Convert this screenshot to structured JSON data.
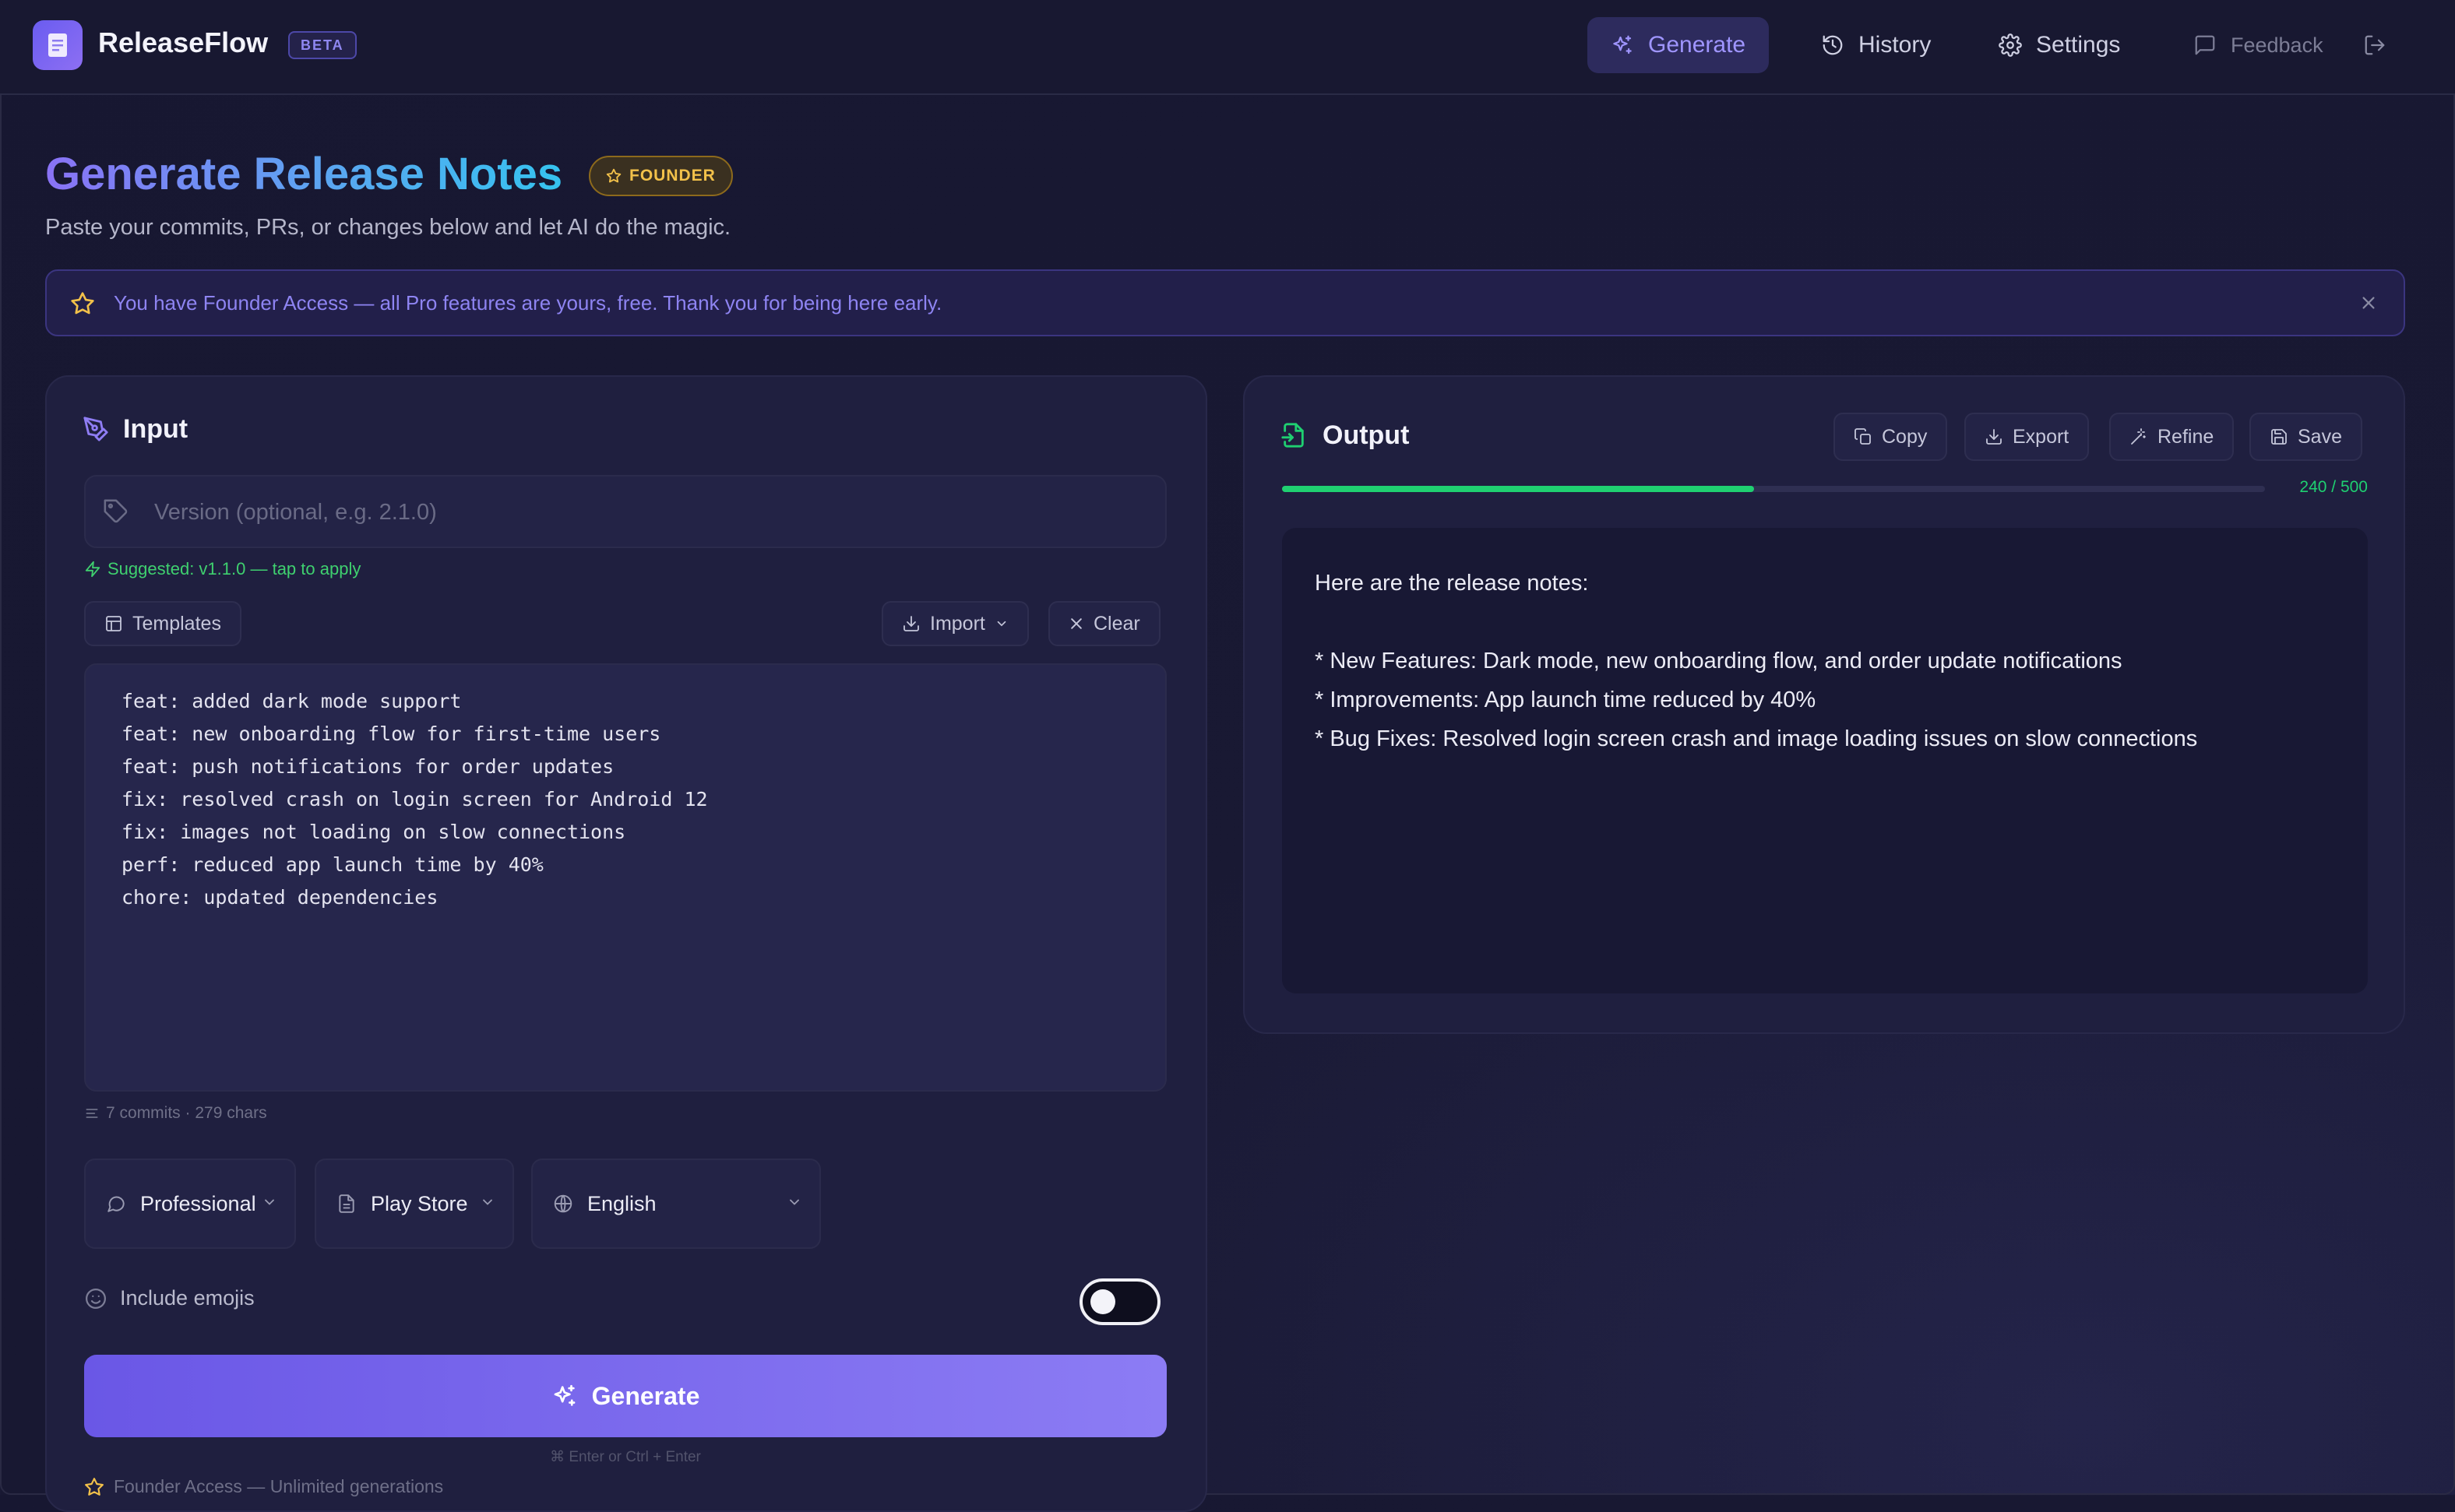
{
  "app": {
    "name": "ReleaseFlow",
    "badge": "BETA"
  },
  "nav": {
    "generate": "Generate",
    "history": "History",
    "settings": "Settings",
    "feedback": "Feedback"
  },
  "header": {
    "title": "Generate Release Notes",
    "founder_badge": "FOUNDER",
    "subtitle": "Paste your commits, PRs, or changes below and let AI do the magic."
  },
  "banner": {
    "text": "You have Founder Access — all Pro features are yours, free. Thank you for being here early."
  },
  "input": {
    "heading": "Input",
    "version_placeholder": "Version (optional, e.g. 2.1.0)",
    "suggestion": "Suggested: v1.1.0 — tap to apply",
    "templates_label": "Templates",
    "import_label": "Import",
    "clear_label": "Clear",
    "commits": "feat: added dark mode support\nfeat: new onboarding flow for first-time users\nfeat: push notifications for order updates\nfix: resolved crash on login screen for Android 12\nfix: images not loading on slow connections\nperf: reduced app launch time by 40%\nchore: updated dependencies",
    "counts": "7 commits · 279 chars",
    "tone": "Professional",
    "platform": "Play Store",
    "language": "English",
    "emoji_label": "Include emojis",
    "emoji_enabled": false,
    "generate_label": "Generate",
    "shortcut": "⌘ Enter  or  Ctrl + Enter",
    "founder_footer": "Founder Access — Unlimited generations"
  },
  "output": {
    "heading": "Output",
    "copy_label": "Copy",
    "export_label": "Export",
    "refine_label": "Refine",
    "save_label": "Save",
    "char_count": "240 / 500",
    "char_used": 240,
    "char_limit": 500,
    "text": "Here are the release notes:\n\n* New Features: Dark mode, new onboarding flow, and order update notifications\n* Improvements: App launch time reduced by 40%\n* Bug Fixes: Resolved login screen crash and image loading issues on slow connections"
  },
  "colors": {
    "accent": "#7c6cf0",
    "success": "#1fd071",
    "founder_gold": "#f2c14a",
    "background": "#191933"
  }
}
